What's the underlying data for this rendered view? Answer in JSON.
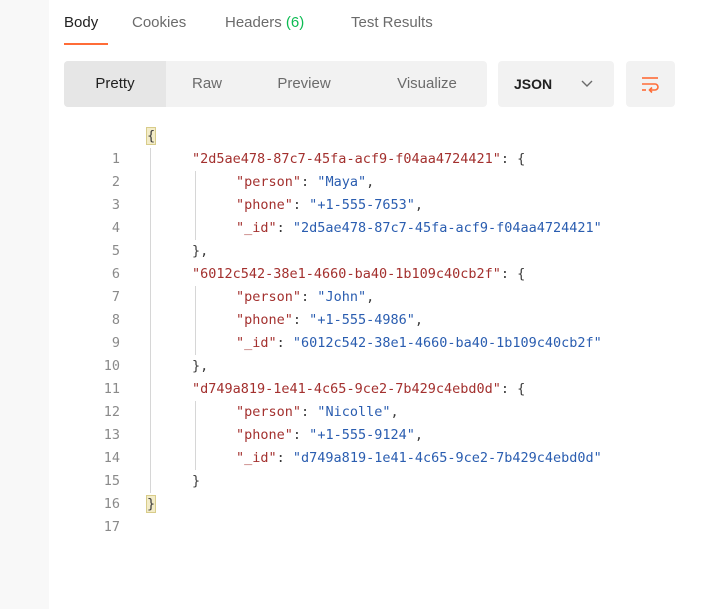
{
  "response_tabs": {
    "body": "Body",
    "cookies": "Cookies",
    "headers_label": "Headers",
    "headers_count": "(6)",
    "test_results": "Test Results"
  },
  "view_modes": {
    "pretty": "Pretty",
    "raw": "Raw",
    "preview": "Preview",
    "visualize": "Visualize"
  },
  "format": {
    "selected": "JSON"
  },
  "icons": {
    "format_dropdown": "chevron-down-icon",
    "wrap": "wrap-lines-icon"
  },
  "colors": {
    "accent": "#ff6c37",
    "count": "#0cbb52",
    "json_key": "#a3302e",
    "json_string": "#2a5db0"
  },
  "code": {
    "line_numbers": [
      "1",
      "2",
      "3",
      "4",
      "5",
      "6",
      "7",
      "8",
      "9",
      "10",
      "11",
      "12",
      "13",
      "14",
      "15",
      "16",
      "17"
    ],
    "entries": [
      {
        "key": "2d5ae478-87c7-45fa-acf9-f04aa4724421",
        "person": "Maya",
        "phone": "+1-555-7653",
        "_id": "2d5ae478-87c7-45fa-acf9-f04aa4724421"
      },
      {
        "key": "6012c542-38e1-4660-ba40-1b109c40cb2f",
        "person": "John",
        "phone": "+1-555-4986",
        "_id": "6012c542-38e1-4660-ba40-1b109c40cb2f"
      },
      {
        "key": "d749a819-1e41-4c65-9ce2-7b429c4ebd0d",
        "person": "Nicolle",
        "phone": "+1-555-9124",
        "_id": "d749a819-1e41-4c65-9ce2-7b429c4ebd0d"
      }
    ]
  }
}
